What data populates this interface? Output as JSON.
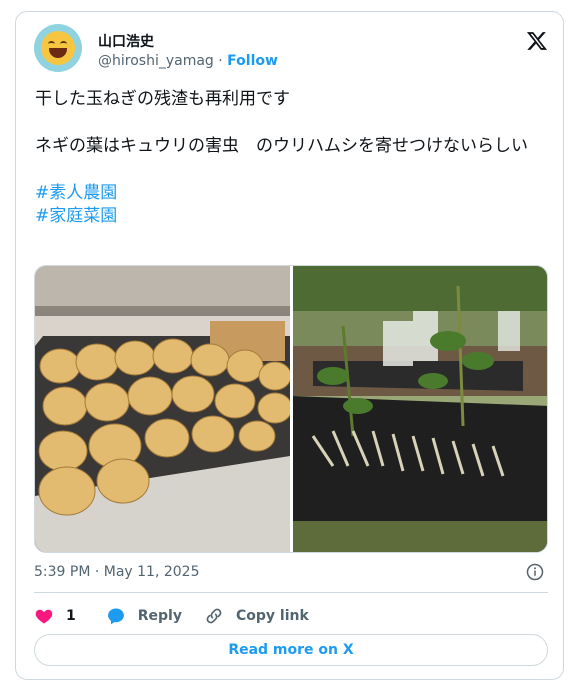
{
  "user": {
    "name": "山口浩史",
    "handle": "@hiroshi_yamag",
    "separator": " · ",
    "follow": "Follow"
  },
  "tweet": {
    "line1": "干した玉ねぎの残渣も再利用です",
    "line2": "ネギの葉はキュウリの害虫　のウリハムシを寄せつけないらしい",
    "hashtags": [
      "#素人農園",
      "#家庭菜園"
    ]
  },
  "timestamp": "5:39 PM · May 11, 2025",
  "actions": {
    "like_count": "1",
    "reply": "Reply",
    "copy_link": "Copy link"
  },
  "read_more": "Read more on X",
  "colors": {
    "accent": "#1d9bf0",
    "like": "#f91880",
    "muted": "#536471"
  },
  "icons": [
    "x-logo-icon",
    "info-icon",
    "heart-icon",
    "reply-icon",
    "link-icon"
  ]
}
